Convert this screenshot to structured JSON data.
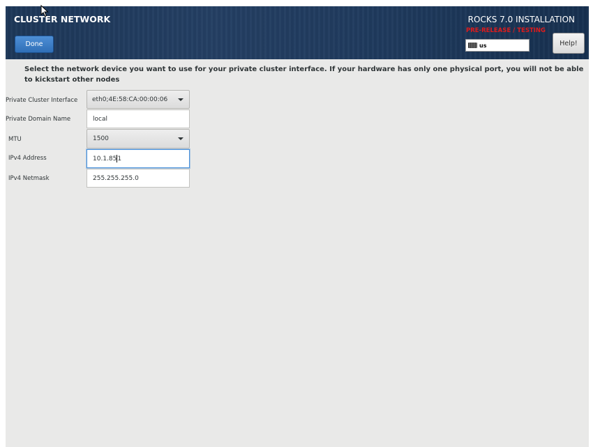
{
  "header": {
    "title": "CLUSTER NETWORK",
    "done_label": "Done",
    "product": "ROCKS 7.0 INSTALLATION",
    "prerelease": "PRE-RELEASE / TESTING",
    "keyboard_layout": "us",
    "help_label": "Help!"
  },
  "instructions": "Select the network device you want to use for your private cluster interface. If your hardware has only one physical port, you will not be able to kickstart other nodes",
  "form": {
    "interface": {
      "label": "Private Cluster Interface",
      "value": "eth0;4E:58:CA:00:00:06"
    },
    "domain": {
      "label": "Private Domain  Name",
      "value": "local"
    },
    "mtu": {
      "label": "MTU",
      "value": "1500"
    },
    "ipv4_address": {
      "label": "IPv4 Address",
      "value_before_caret": "10.1.85",
      "value_after_caret": "1"
    },
    "ipv4_netmask": {
      "label": "IPv4 Netmask",
      "value": "255.255.255.0"
    }
  },
  "colors": {
    "header_bg": "#1f3a5d",
    "prerelease": "#e01b1b",
    "done_button": "#3b7dc7",
    "body_bg": "#e9e9e8",
    "focus": "#4a90d9"
  }
}
